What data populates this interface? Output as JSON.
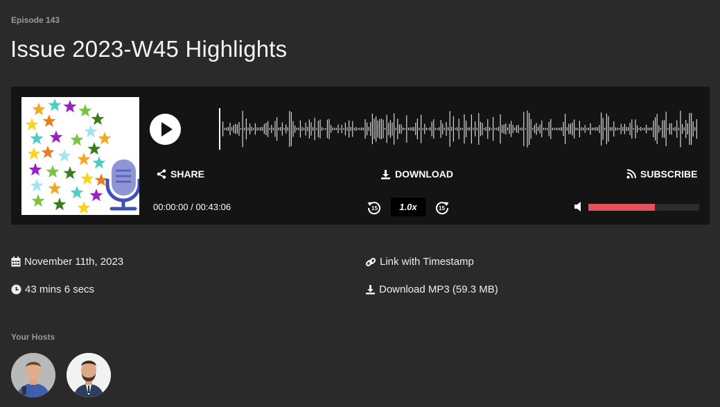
{
  "episode": {
    "label": "Episode 143",
    "title": "Issue 2023-W45 Highlights"
  },
  "player": {
    "actions": {
      "share": "SHARE",
      "download": "DOWNLOAD",
      "subscribe": "SUBSCRIBE"
    },
    "current_time": "00:00:00",
    "duration": "00:43:06",
    "time_display": "00:00:00 / 00:43:06",
    "speed": "1.0x",
    "skip_back_seconds": "15",
    "skip_forward_seconds": "15",
    "volume_level": 0.6,
    "accent_color": "#e5515a",
    "icons": [
      "play-icon",
      "share-icon",
      "download-icon",
      "rss-icon",
      "rewind-15-icon",
      "forward-15-icon",
      "volume-icon"
    ]
  },
  "details": {
    "date": "November 11th, 2023",
    "length": "43 mins 6 secs",
    "timestamp_link": "Link with Timestamp",
    "download_mp3": "Download MP3 (59.3 MB)"
  },
  "hosts": {
    "label": "Your Hosts",
    "count": 2
  }
}
